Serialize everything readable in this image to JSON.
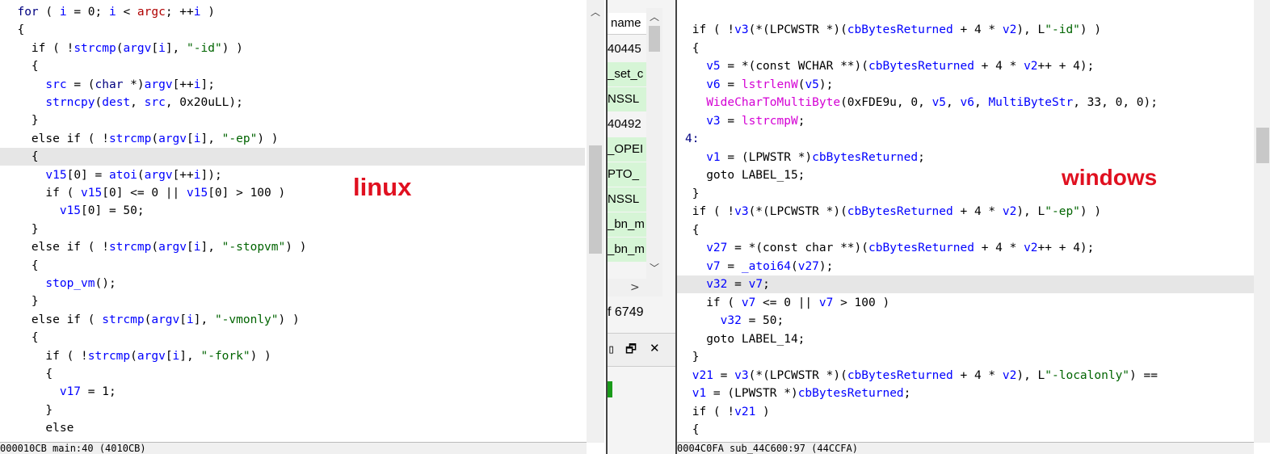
{
  "left_pane": {
    "overlay_label": "linux",
    "highlight_line": 8,
    "lines": [
      [
        [
          "kw",
          "  for"
        ],
        [
          "plain",
          " ( "
        ],
        [
          "var-text",
          "i"
        ],
        [
          "plain",
          " = 0; "
        ],
        [
          "var-text",
          "i"
        ],
        [
          "plain",
          " < "
        ],
        [
          "arg-red",
          "argc"
        ],
        [
          "plain",
          "; ++"
        ],
        [
          "var-text",
          "i"
        ],
        [
          "plain",
          " )"
        ]
      ],
      [
        [
          "plain",
          "  {"
        ]
      ],
      [
        [
          "plain",
          "    if ( !"
        ],
        [
          "fn-text",
          "strcmp"
        ],
        [
          "plain",
          "("
        ],
        [
          "var-text",
          "argv"
        ],
        [
          "plain",
          "["
        ],
        [
          "var-text",
          "i"
        ],
        [
          "plain",
          "], "
        ],
        [
          "str",
          "\"-id\""
        ],
        [
          "plain",
          ") )"
        ]
      ],
      [
        [
          "plain",
          "    {"
        ]
      ],
      [
        [
          "plain",
          "      "
        ],
        [
          "var-text",
          "src"
        ],
        [
          "plain",
          " = ("
        ],
        [
          "kw",
          "char"
        ],
        [
          "plain",
          " *)"
        ],
        [
          "var-text",
          "argv"
        ],
        [
          "plain",
          "[++"
        ],
        [
          "var-text",
          "i"
        ],
        [
          "plain",
          "];"
        ]
      ],
      [
        [
          "plain",
          "      "
        ],
        [
          "fn-text",
          "strncpy"
        ],
        [
          "plain",
          "("
        ],
        [
          "var-text",
          "dest"
        ],
        [
          "plain",
          ", "
        ],
        [
          "var-text",
          "src"
        ],
        [
          "plain",
          ", 0x20uLL);"
        ]
      ],
      [
        [
          "plain",
          "    }"
        ]
      ],
      [
        [
          "plain",
          "    else if ( !"
        ],
        [
          "fn-text",
          "strcmp"
        ],
        [
          "plain",
          "("
        ],
        [
          "var-text",
          "argv"
        ],
        [
          "plain",
          "["
        ],
        [
          "var-text",
          "i"
        ],
        [
          "plain",
          "], "
        ],
        [
          "str",
          "\"-ep\""
        ],
        [
          "plain",
          ") )"
        ]
      ],
      [
        [
          "plain",
          "    {"
        ]
      ],
      [
        [
          "plain",
          "      "
        ],
        [
          "var-text",
          "v15"
        ],
        [
          "plain",
          "[0] = "
        ],
        [
          "fn-text",
          "atoi"
        ],
        [
          "plain",
          "("
        ],
        [
          "var-text",
          "argv"
        ],
        [
          "plain",
          "[++"
        ],
        [
          "var-text",
          "i"
        ],
        [
          "plain",
          "]);"
        ]
      ],
      [
        [
          "plain",
          "      if ( "
        ],
        [
          "var-text",
          "v15"
        ],
        [
          "plain",
          "[0] <= 0 || "
        ],
        [
          "var-text",
          "v15"
        ],
        [
          "plain",
          "[0] > 100 )"
        ]
      ],
      [
        [
          "plain",
          "        "
        ],
        [
          "var-text",
          "v15"
        ],
        [
          "plain",
          "[0] = 50;"
        ]
      ],
      [
        [
          "plain",
          "    }"
        ]
      ],
      [
        [
          "plain",
          "    else if ( !"
        ],
        [
          "fn-text",
          "strcmp"
        ],
        [
          "plain",
          "("
        ],
        [
          "var-text",
          "argv"
        ],
        [
          "plain",
          "["
        ],
        [
          "var-text",
          "i"
        ],
        [
          "plain",
          "], "
        ],
        [
          "str",
          "\"-stopvm\""
        ],
        [
          "plain",
          ") )"
        ]
      ],
      [
        [
          "plain",
          "    {"
        ]
      ],
      [
        [
          "plain",
          "      "
        ],
        [
          "fn-text",
          "stop_vm"
        ],
        [
          "plain",
          "();"
        ]
      ],
      [
        [
          "plain",
          "    }"
        ]
      ],
      [
        [
          "plain",
          "    else if ( "
        ],
        [
          "fn-text",
          "strcmp"
        ],
        [
          "plain",
          "("
        ],
        [
          "var-text",
          "argv"
        ],
        [
          "plain",
          "["
        ],
        [
          "var-text",
          "i"
        ],
        [
          "plain",
          "], "
        ],
        [
          "str",
          "\"-vmonly\""
        ],
        [
          "plain",
          ") )"
        ]
      ],
      [
        [
          "plain",
          "    {"
        ]
      ],
      [
        [
          "plain",
          "      if ( !"
        ],
        [
          "fn-text",
          "strcmp"
        ],
        [
          "plain",
          "("
        ],
        [
          "var-text",
          "argv"
        ],
        [
          "plain",
          "["
        ],
        [
          "var-text",
          "i"
        ],
        [
          "plain",
          "], "
        ],
        [
          "str",
          "\"-fork\""
        ],
        [
          "plain",
          ") )"
        ]
      ],
      [
        [
          "plain",
          "      {"
        ]
      ],
      [
        [
          "plain",
          "        "
        ],
        [
          "var-text",
          "v17"
        ],
        [
          "plain",
          " = 1;"
        ]
      ],
      [
        [
          "plain",
          "      }"
        ]
      ],
      [
        [
          "plain",
          "      else"
        ]
      ]
    ],
    "status": "000010CB main:40 (4010CB)"
  },
  "middle_pane": {
    "column_header": "name",
    "rows": [
      {
        "text": "40445",
        "green": false
      },
      {
        "text": "_set_c",
        "green": true
      },
      {
        "text": "NSSL",
        "green": true
      },
      {
        "text": "40492",
        "green": false
      },
      {
        "text": "_OPEI",
        "green": true
      },
      {
        "text": "PTO_",
        "green": true
      },
      {
        "text": "NSSL",
        "green": true
      },
      {
        "text": "_bn_m",
        "green": true
      },
      {
        "text": "_bn_m",
        "green": true
      }
    ],
    "count_text": "f 6749",
    "restore_icon_glyph": "🗗",
    "close_icon_glyph": "✕",
    "pane_icon_glyph": "▯"
  },
  "right_pane": {
    "overlay_label": "windows",
    "highlight_line": 14,
    "lines": [
      [
        [
          "plain",
          " if ( !"
        ],
        [
          "var-text",
          "v3"
        ],
        [
          "plain",
          "(*(LPCWSTR *)("
        ],
        [
          "var-text",
          "cbBytesReturned"
        ],
        [
          "plain",
          " + 4 * "
        ],
        [
          "var-text",
          "v2"
        ],
        [
          "plain",
          "), L"
        ],
        [
          "str",
          "\"-id\""
        ],
        [
          "plain",
          ") )"
        ]
      ],
      [
        [
          "plain",
          " {"
        ]
      ],
      [
        [
          "plain",
          "   "
        ],
        [
          "var-text",
          "v5"
        ],
        [
          "plain",
          " = *(const WCHAR **)("
        ],
        [
          "var-text",
          "cbBytesReturned"
        ],
        [
          "plain",
          " + 4 * "
        ],
        [
          "var-text",
          "v2"
        ],
        [
          "plain",
          "++ + 4);"
        ]
      ],
      [
        [
          "plain",
          "   "
        ],
        [
          "var-text",
          "v6"
        ],
        [
          "plain",
          " = "
        ],
        [
          "api",
          "lstrlenW"
        ],
        [
          "plain",
          "("
        ],
        [
          "var-text",
          "v5"
        ],
        [
          "plain",
          ");"
        ]
      ],
      [
        [
          "plain",
          "   "
        ],
        [
          "api",
          "WideCharToMultiByte"
        ],
        [
          "plain",
          "(0xFDE9u, 0, "
        ],
        [
          "var-text",
          "v5"
        ],
        [
          "plain",
          ", "
        ],
        [
          "var-text",
          "v6"
        ],
        [
          "plain",
          ", "
        ],
        [
          "var-text",
          "MultiByteStr"
        ],
        [
          "plain",
          ", 33, 0, 0);"
        ]
      ],
      [
        [
          "plain",
          "   "
        ],
        [
          "var-text",
          "v3"
        ],
        [
          "plain",
          " = "
        ],
        [
          "api",
          "lstrcmpW"
        ],
        [
          "plain",
          ";"
        ]
      ],
      [
        [
          "lbl",
          "4:"
        ]
      ],
      [
        [
          "plain",
          "   "
        ],
        [
          "var-text",
          "v1"
        ],
        [
          "plain",
          " = (LPWSTR *)"
        ],
        [
          "var-text",
          "cbBytesReturned"
        ],
        [
          "plain",
          ";"
        ]
      ],
      [
        [
          "plain",
          "   goto LABEL_15;"
        ]
      ],
      [
        [
          "plain",
          " }"
        ]
      ],
      [
        [
          "plain",
          " if ( !"
        ],
        [
          "var-text",
          "v3"
        ],
        [
          "plain",
          "(*(LPCWSTR *)("
        ],
        [
          "var-text",
          "cbBytesReturned"
        ],
        [
          "plain",
          " + 4 * "
        ],
        [
          "var-text",
          "v2"
        ],
        [
          "plain",
          "), L"
        ],
        [
          "str",
          "\"-ep\""
        ],
        [
          "plain",
          ") )"
        ]
      ],
      [
        [
          "plain",
          " {"
        ]
      ],
      [
        [
          "plain",
          "   "
        ],
        [
          "var-text",
          "v27"
        ],
        [
          "plain",
          " = *(const char **)("
        ],
        [
          "var-text",
          "cbBytesReturned"
        ],
        [
          "plain",
          " + 4 * "
        ],
        [
          "var-text",
          "v2"
        ],
        [
          "plain",
          "++ + 4);"
        ]
      ],
      [
        [
          "plain",
          "   "
        ],
        [
          "var-text",
          "v7"
        ],
        [
          "plain",
          " = "
        ],
        [
          "fn-text",
          "_atoi64"
        ],
        [
          "plain",
          "("
        ],
        [
          "var-text",
          "v27"
        ],
        [
          "plain",
          ");"
        ]
      ],
      [
        [
          "plain",
          "   "
        ],
        [
          "var-text",
          "v32"
        ],
        [
          "plain",
          " = "
        ],
        [
          "var-text",
          "v7"
        ],
        [
          "plain",
          ";"
        ]
      ],
      [
        [
          "plain",
          "   if ( "
        ],
        [
          "var-text",
          "v7"
        ],
        [
          "plain",
          " <= 0 || "
        ],
        [
          "var-text",
          "v7"
        ],
        [
          "plain",
          " > 100 )"
        ]
      ],
      [
        [
          "plain",
          "     "
        ],
        [
          "var-text",
          "v32"
        ],
        [
          "plain",
          " = 50;"
        ]
      ],
      [
        [
          "plain",
          "   goto LABEL_14;"
        ]
      ],
      [
        [
          "plain",
          " }"
        ]
      ],
      [
        [
          "plain",
          " "
        ],
        [
          "var-text",
          "v21"
        ],
        [
          "plain",
          " = "
        ],
        [
          "var-text",
          "v3"
        ],
        [
          "plain",
          "(*(LPCWSTR *)("
        ],
        [
          "var-text",
          "cbBytesReturned"
        ],
        [
          "plain",
          " + 4 * "
        ],
        [
          "var-text",
          "v2"
        ],
        [
          "plain",
          "), L"
        ],
        [
          "str",
          "\"-localonly\""
        ],
        [
          "plain",
          ") =="
        ]
      ],
      [
        [
          "plain",
          " "
        ],
        [
          "var-text",
          "v1"
        ],
        [
          "plain",
          " = (LPWSTR *)"
        ],
        [
          "var-text",
          "cbBytesReturned"
        ],
        [
          "plain",
          ";"
        ]
      ],
      [
        [
          "plain",
          " if ( !"
        ],
        [
          "var-text",
          "v21"
        ],
        [
          "plain",
          " )"
        ]
      ],
      [
        [
          "plain",
          " {"
        ]
      ]
    ],
    "status": "0004C0FA sub_44C600:97 (44CCFA)"
  }
}
